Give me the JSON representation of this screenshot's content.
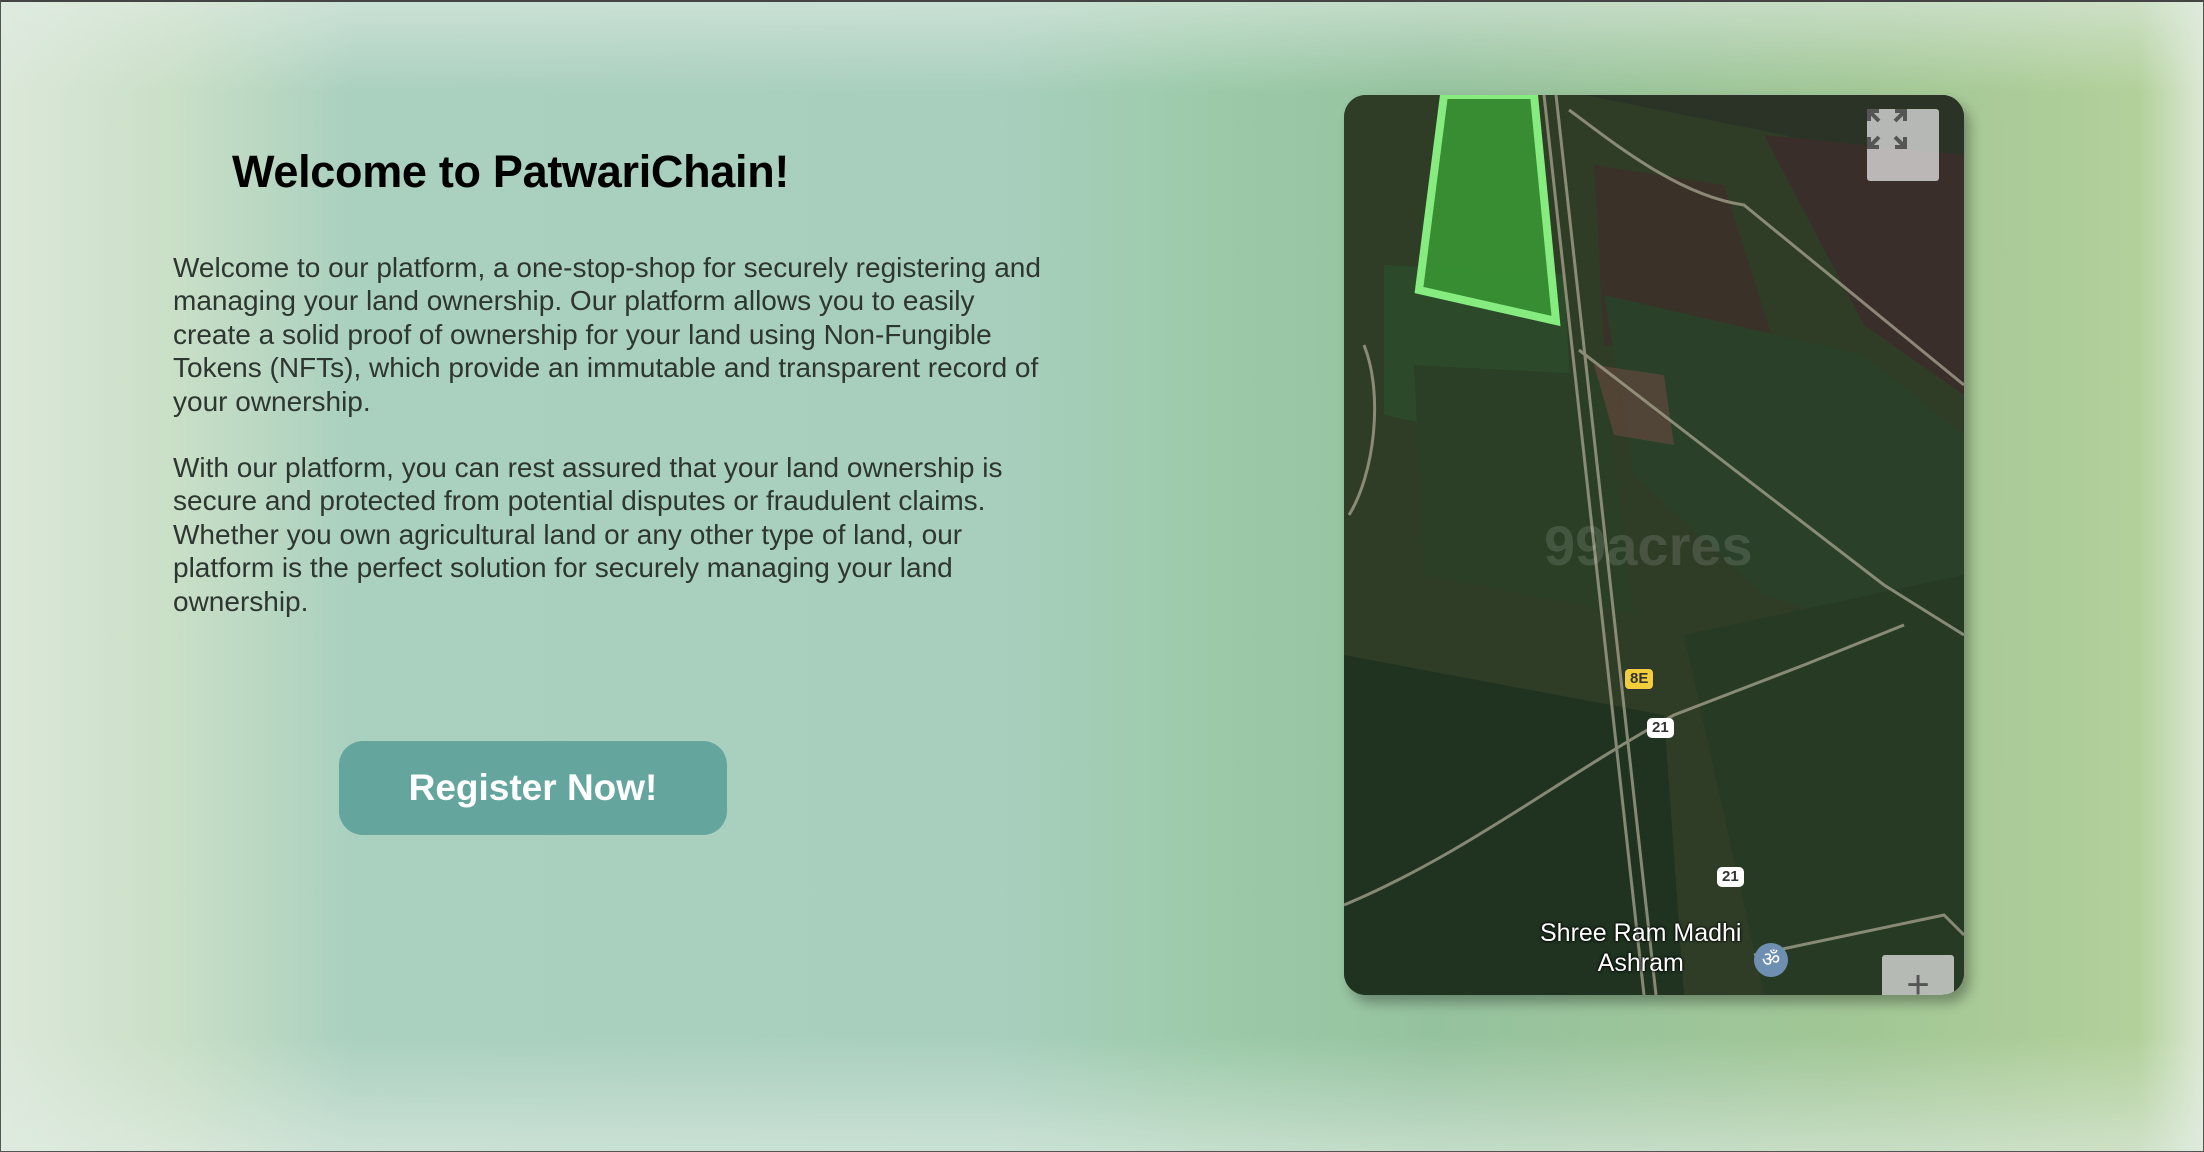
{
  "hero": {
    "title": "Welcome to PatwariChain!",
    "paragraphs": [
      "Welcome to our platform, a one-stop-shop for securely registering and managing your land ownership. Our platform allows you to easily create a solid proof of ownership for your land using Non-Fungible Tokens (NFTs), which provide an immutable and transparent record of your ownership.",
      "With our platform, you can rest assured that your land ownership is secure and protected from potential disputes or fraudulent claims. Whether you own agricultural land or any other type of land, our platform is the perfect solution for securely managing your land ownership."
    ],
    "register_label": "Register Now!"
  },
  "map": {
    "watermark": "99acres",
    "place_label_line1": "Shree Ram Madhi",
    "place_label_line2": "Ashram",
    "road_shields": [
      "8E",
      "21",
      "21"
    ],
    "zoom_in_label": "+",
    "icons": [
      "fullscreen-icon",
      "om-temple-icon"
    ],
    "plot_color": "#7fe07a"
  }
}
